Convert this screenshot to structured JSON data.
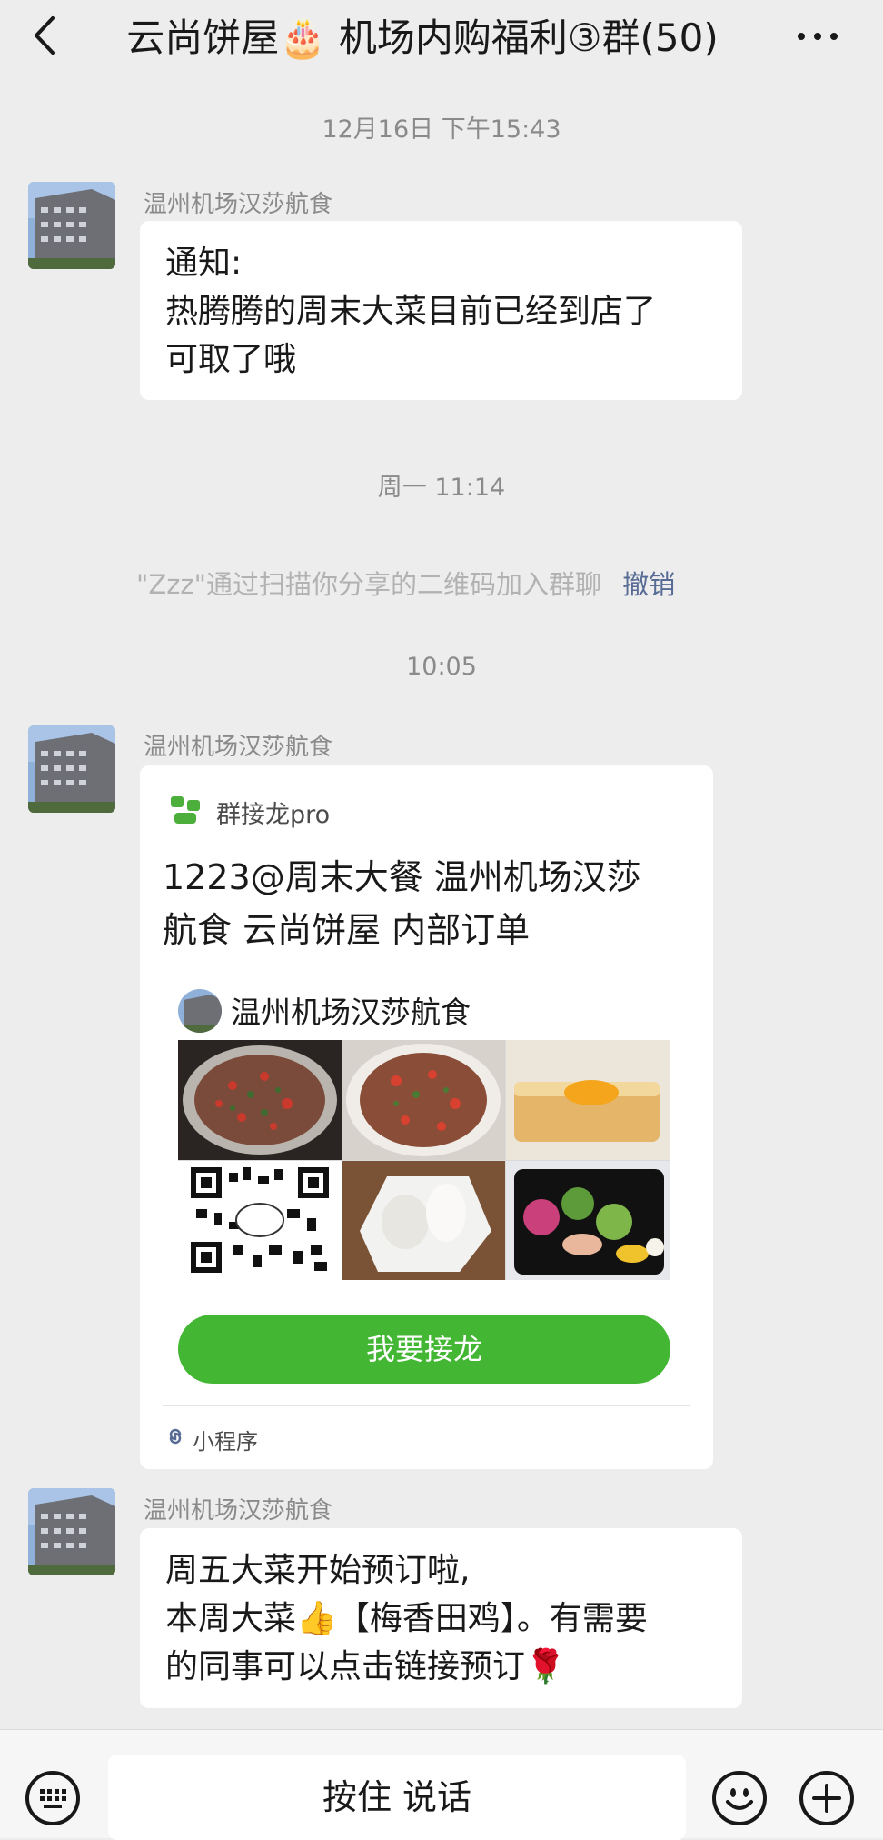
{
  "header": {
    "title": "云尚饼屋🎂 机场内购福利③群(50)"
  },
  "timestamps": [
    "12月16日 下午15:43",
    "周一 11:14",
    "10:05"
  ],
  "messages": [
    {
      "sender": "温州机场汉莎航食",
      "lines": [
        "通知:",
        "热腾腾的周末大菜目前已经到店了",
        "可取了哦"
      ]
    },
    {
      "sender": "温州机场汉莎航食",
      "card": {
        "app_name": "群接龙pro",
        "title_lines": [
          "1223@周末大餐 温州机场汉莎",
          "航食 云尚饼屋 内部订单"
        ],
        "account_name": "温州机场汉莎航食",
        "action_label": "我要接龙",
        "footer": "小程序",
        "accent": "#43b734"
      }
    },
    {
      "sender": "温州机场汉莎航食",
      "lines": [
        "周五大菜开始预订啦,",
        "本周大菜👍【梅香田鸡】。有需要",
        "的同事可以点击链接预订🌹"
      ]
    }
  ],
  "system_message": {
    "name": "\"Zzz\"",
    "text": "通过扫描你分享的二维码加入群聊",
    "action": "撤销"
  },
  "input_bar": {
    "talk_label": "按住 说话"
  }
}
